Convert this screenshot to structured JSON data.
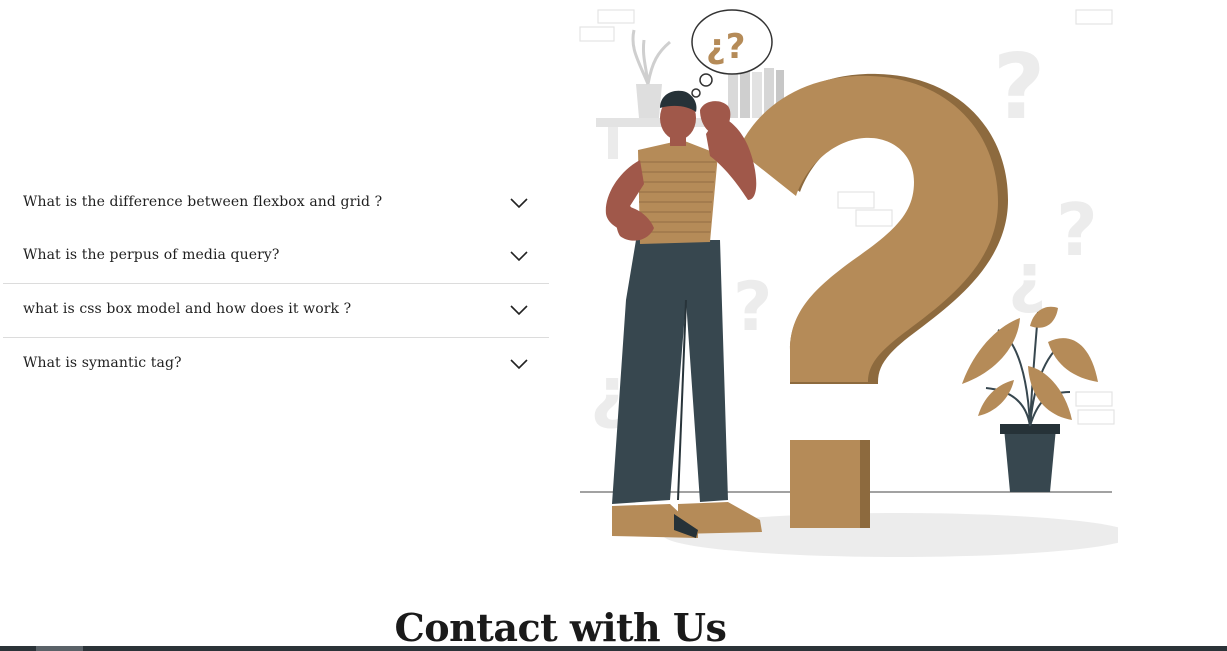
{
  "faq": {
    "items": [
      {
        "question": "What is the difference between flexbox and grid ?"
      },
      {
        "question": "What is the perpus of media query?"
      },
      {
        "question": "what is css box model and how does it work ?"
      },
      {
        "question": "What is symantic tag?"
      }
    ]
  },
  "illustration": {
    "bubble_text": "¿?"
  },
  "contact": {
    "title": "Contact with Us"
  },
  "colors": {
    "accent": "#b58b58",
    "accent_dark": "#8d6a3e",
    "pants": "#37474f",
    "skin": "#a0584a"
  }
}
